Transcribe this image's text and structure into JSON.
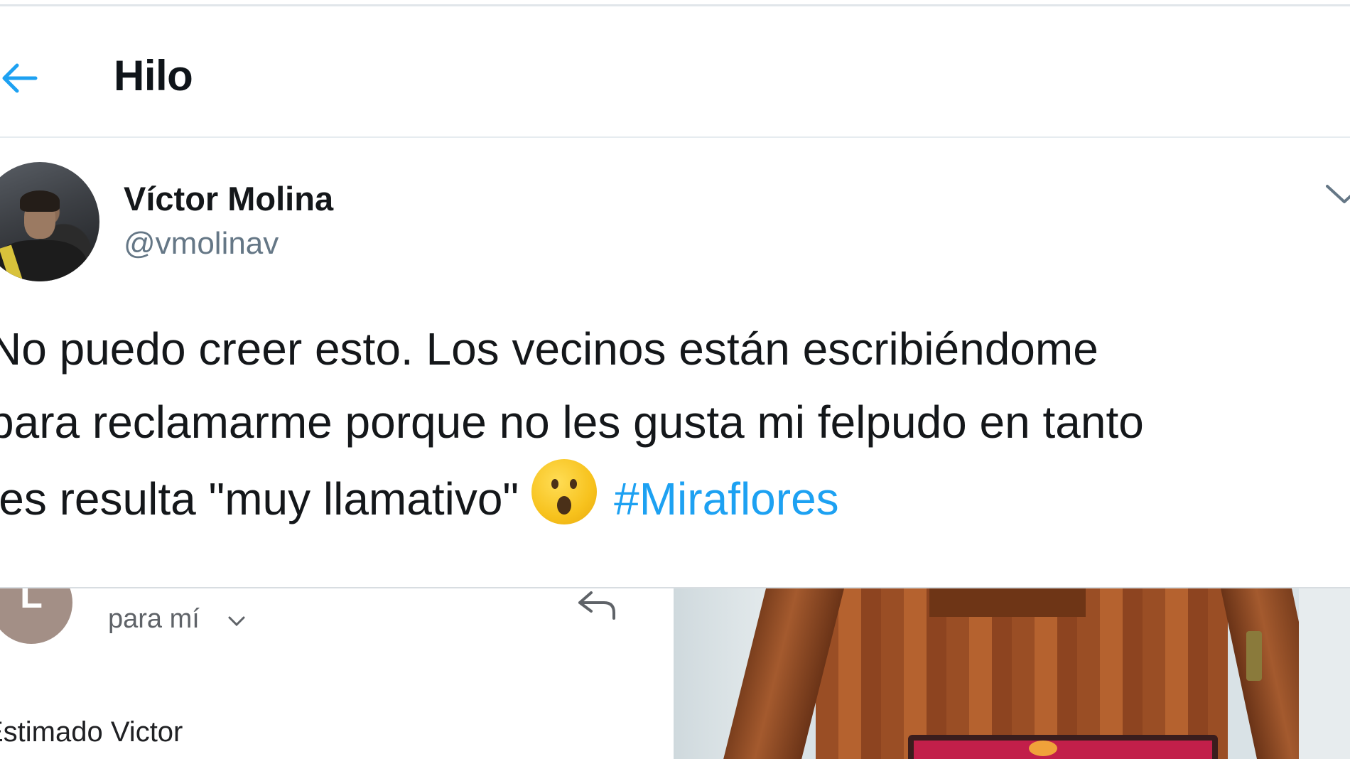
{
  "header": {
    "title": "Hilo",
    "back_icon": "arrow-left-icon"
  },
  "tweet": {
    "author_name": "Víctor Molina",
    "author_handle": "@vmolinav",
    "text_lines": [
      "No puedo creer esto. Los vecinos están escribiéndome",
      "para reclamarme porque no les gusta mi felpudo en tanto",
      "les resulta \"muy llamativo\""
    ],
    "emoji": "hushed-face-emoji",
    "hashtag": "#Miraflores",
    "menu_icon": "chevron-down-icon"
  },
  "embedded_email": {
    "sender_initial": "L",
    "recipient": "para mí",
    "greeting": "Estimado Victor",
    "reply_icon": "reply-icon"
  },
  "colors": {
    "accent": "#1da1f2",
    "text_primary": "#14171a",
    "text_secondary": "#657786",
    "divider": "#e6ecf0"
  }
}
